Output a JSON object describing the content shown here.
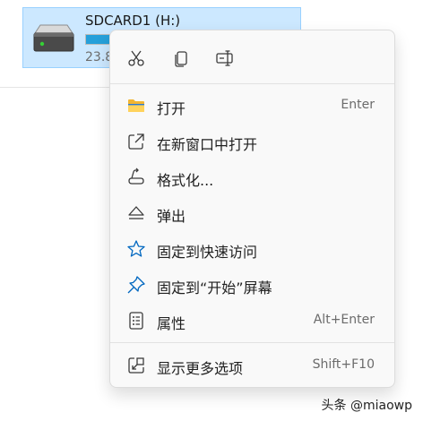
{
  "drive": {
    "name": "SDCARD1 (H:)",
    "size_text": "23.8",
    "usage_fraction": 0.13
  },
  "menu": {
    "quick_actions": [
      {
        "icon": "cut-icon"
      },
      {
        "icon": "copy-icon"
      },
      {
        "icon": "rename-icon"
      }
    ],
    "items": [
      {
        "label": "打开",
        "shortcut": "Enter",
        "icon": "folder-icon"
      },
      {
        "label": "在新窗口中打开",
        "shortcut": "",
        "icon": "open-new-window-icon"
      },
      {
        "label": "格式化...",
        "shortcut": "",
        "icon": "format-icon"
      },
      {
        "label": "弹出",
        "shortcut": "",
        "icon": "eject-icon"
      },
      {
        "label": "固定到快速访问",
        "shortcut": "",
        "icon": "star-icon"
      },
      {
        "label": "固定到“开始”屏幕",
        "shortcut": "",
        "icon": "pin-icon"
      },
      {
        "label": "属性",
        "shortcut": "Alt+Enter",
        "icon": "properties-icon"
      },
      {
        "label": "显示更多选项",
        "shortcut": "Shift+F10",
        "icon": "more-options-icon"
      }
    ]
  },
  "watermark": "头条 @miaowp",
  "colors": {
    "accent": "#0067c0",
    "selection_bg": "#cce8ff",
    "menu_bg": "#f9f9f9",
    "folder_yellow": "#f6c344"
  }
}
